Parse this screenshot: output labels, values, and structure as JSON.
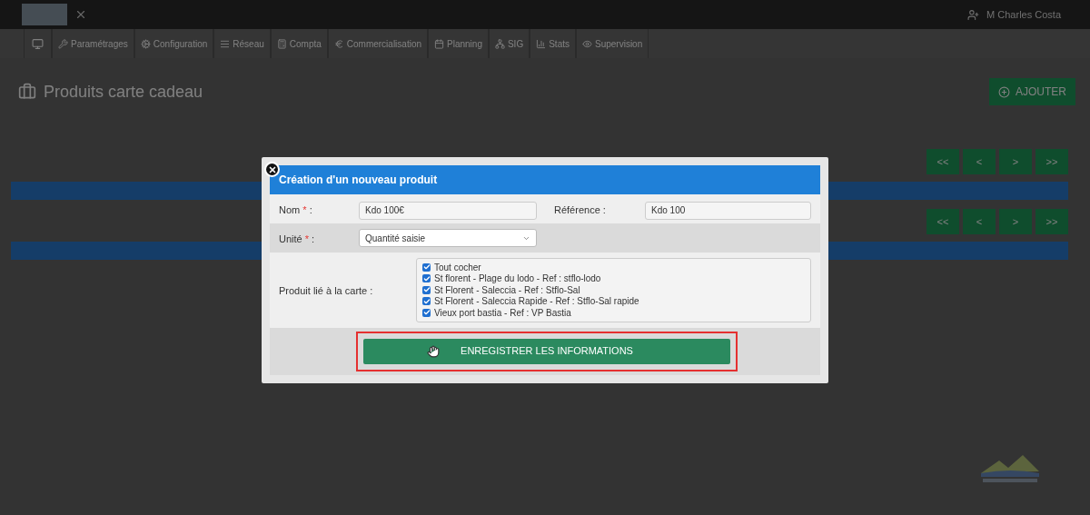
{
  "header": {
    "user": "M Charles Costa"
  },
  "nav": [
    {
      "label": "Paramétrages"
    },
    {
      "label": "Configuration"
    },
    {
      "label": "Réseau"
    },
    {
      "label": "Compta"
    },
    {
      "label": "Commercialisation"
    },
    {
      "label": "Planning"
    },
    {
      "label": "SIG"
    },
    {
      "label": "Stats"
    },
    {
      "label": "Supervision"
    }
  ],
  "page": {
    "title": "Produits carte cadeau",
    "add_button": "AJOUTER"
  },
  "pagination": [
    [
      "<<",
      "<",
      ">",
      ">>"
    ],
    [
      "<<",
      "<",
      ">",
      ">>"
    ]
  ],
  "modal": {
    "title": "Création d'un nouveau produit",
    "fields": [
      {
        "kind": "text",
        "label": "Nom",
        "mark": "*",
        "colon": ":",
        "value": "Kdo 100€"
      },
      {
        "kind": "text",
        "label": "Référence",
        "colon": ":",
        "value": "Kdo 100"
      },
      {
        "kind": "select",
        "label": "Unité",
        "mark": "*",
        "colon": ":",
        "value": "Quantité saisie"
      }
    ],
    "products": {
      "label": "Produit lié à la carte",
      "colon": ":",
      "items": [
        {
          "label": "Tout cocher",
          "checked": true
        },
        {
          "label": "St florent - Plage du lodo - Ref : stflo-lodo",
          "checked": true
        },
        {
          "label": "St Florent - Saleccia - Ref : Stflo-Sal",
          "checked": true
        },
        {
          "label": "St Florent - Saleccia Rapide - Ref : Stflo-Sal rapide",
          "checked": true
        },
        {
          "label": "Vieux port bastia - Ref : VP Bastia",
          "checked": true
        }
      ]
    },
    "submit": {
      "label": "ENREGISTRER LES INFORMATIONS",
      "highlighted": true
    }
  }
}
